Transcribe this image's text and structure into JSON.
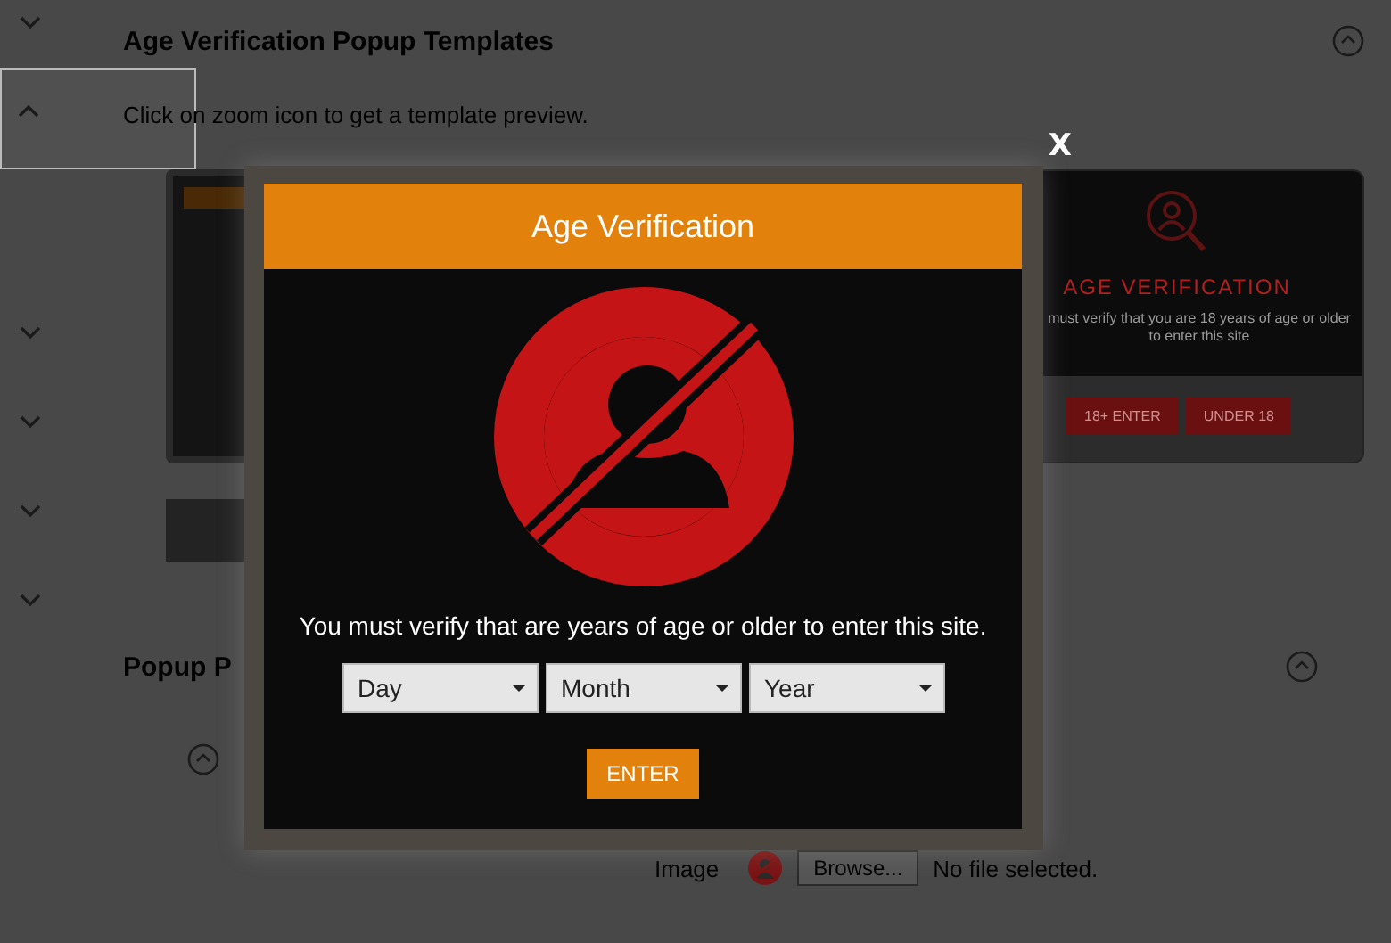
{
  "sidebar": {
    "toggles": [
      {
        "expanded": false,
        "selected": false
      },
      {
        "expanded": true,
        "selected": true
      },
      {
        "expanded": false,
        "selected": false
      },
      {
        "expanded": false,
        "selected": false
      },
      {
        "expanded": false,
        "selected": false
      },
      {
        "expanded": false,
        "selected": false
      }
    ]
  },
  "section": {
    "title": "Age Verification Popup Templates",
    "expanded": true,
    "hint": "Click on zoom icon to get a template preview."
  },
  "templates": [
    {
      "kind": "banner"
    },
    {
      "kind": "badge",
      "title": "AGE VERIFICATION",
      "text": "must verify that you are 18 years of age or older to enter this site",
      "buttons": [
        "18+ ENTER",
        "UNDER 18"
      ]
    }
  ],
  "popup_section": {
    "title": "Popup P",
    "expanded": true
  },
  "image_field": {
    "label": "Image",
    "button": "Browse...",
    "status": "No file selected."
  },
  "popup": {
    "title": "Age Verification",
    "close": "X",
    "message": "You must verify that are years of age or older to enter this site.",
    "selects": [
      {
        "value": "Day"
      },
      {
        "value": "Month"
      },
      {
        "value": "Year"
      }
    ],
    "button": "ENTER"
  }
}
